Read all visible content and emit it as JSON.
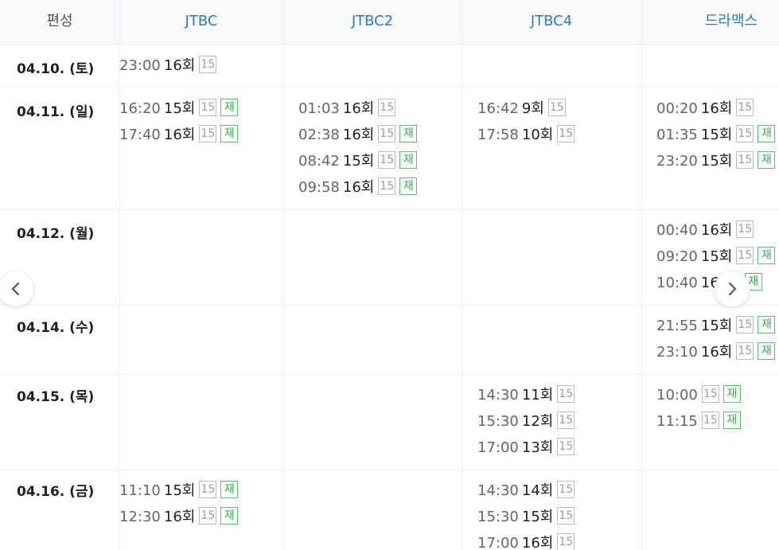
{
  "header": {
    "date_label": "편성",
    "channels": [
      "JTBC",
      "JTBC2",
      "JTBC4",
      "드라맥스"
    ]
  },
  "badges": {
    "age": "15",
    "rerun": "재"
  },
  "rows": [
    {
      "date": "04.10. (토)"
    },
    {
      "date": "04.11. (일)"
    },
    {
      "date": "04.12. (월)"
    },
    {
      "date": "04.14. (수)"
    },
    {
      "date": "04.15. (목)"
    },
    {
      "date": "04.16. (금)"
    }
  ],
  "schedule": [
    {
      "time": "23:00",
      "episode": "16회",
      "rerun": false
    },
    {
      "time": "16:20",
      "episode": "15회",
      "rerun": true
    },
    {
      "time": "17:40",
      "episode": "16회",
      "rerun": true
    },
    {
      "time": "01:03",
      "episode": "16회",
      "rerun": false
    },
    {
      "time": "02:38",
      "episode": "16회",
      "rerun": true
    },
    {
      "time": "08:42",
      "episode": "15회",
      "rerun": true
    },
    {
      "time": "09:58",
      "episode": "16회",
      "rerun": true
    },
    {
      "time": "16:42",
      "episode": "9회",
      "rerun": false
    },
    {
      "time": "17:58",
      "episode": "10회",
      "rerun": false
    },
    {
      "time": "00:20",
      "episode": "16회",
      "rerun": false
    },
    {
      "time": "01:35",
      "episode": "15회",
      "rerun": true
    },
    {
      "time": "23:20",
      "episode": "15회",
      "rerun": true
    },
    {
      "time": "00:40",
      "episode": "16회",
      "rerun": false
    },
    {
      "time": "09:20",
      "episode": "15회",
      "rerun": true
    },
    {
      "time": "10:40",
      "episode": "16",
      "rerun": true
    },
    {
      "time": "21:55",
      "episode": "15회",
      "rerun": true
    },
    {
      "time": "23:10",
      "episode": "16회",
      "rerun": true
    },
    {
      "time": "14:30",
      "episode": "11회",
      "rerun": false
    },
    {
      "time": "15:30",
      "episode": "12회",
      "rerun": false
    },
    {
      "time": "17:00",
      "episode": "13회",
      "rerun": false
    },
    {
      "time": "10:00",
      "episode": "",
      "rerun": true
    },
    {
      "time": "11:15",
      "episode": "",
      "rerun": true
    },
    {
      "time": "11:10",
      "episode": "15회",
      "rerun": true
    },
    {
      "time": "12:30",
      "episode": "16회",
      "rerun": true
    },
    {
      "time": "14:30",
      "episode": "14회",
      "rerun": false
    },
    {
      "time": "15:30",
      "episode": "15회",
      "rerun": false
    },
    {
      "time": "17:00",
      "episode": "16회",
      "rerun": false
    }
  ],
  "nav": {
    "prev_icon": "chevron-left-icon",
    "next_icon": "chevron-right-icon"
  }
}
